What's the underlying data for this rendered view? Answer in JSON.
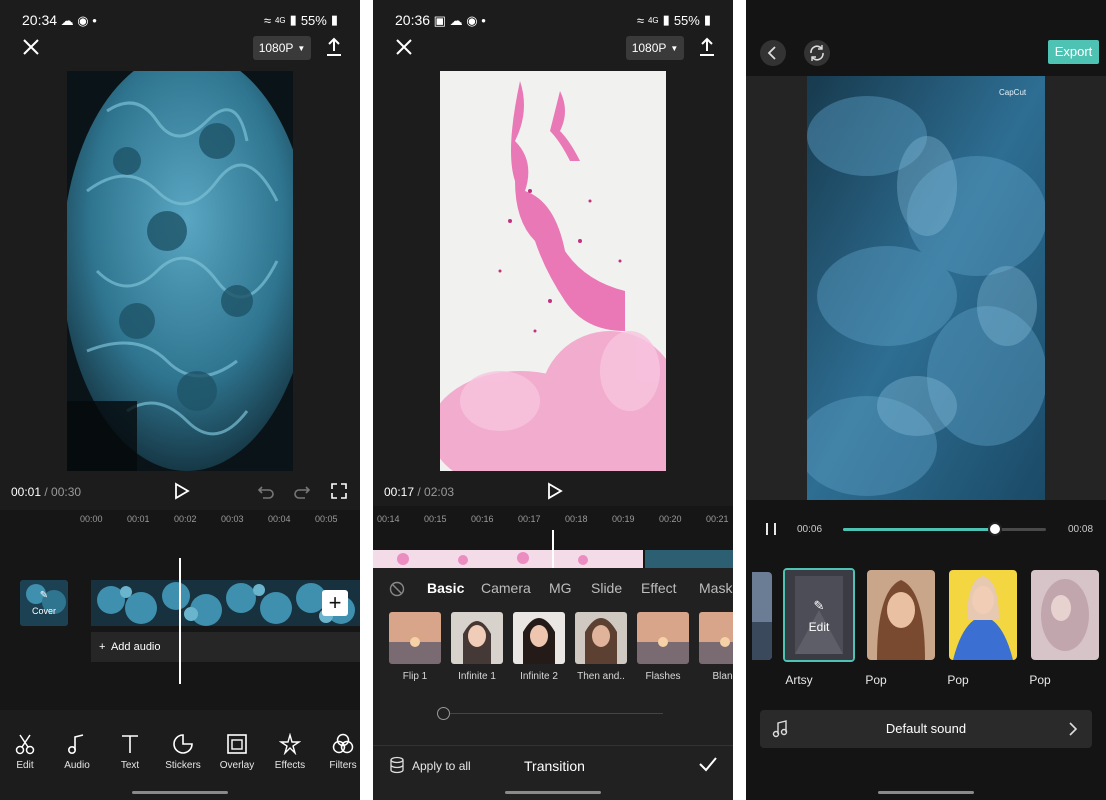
{
  "screen1": {
    "status": {
      "time": "20:34",
      "battery": "55%",
      "signal": "4G"
    },
    "resolution": "1080P",
    "time_current": "00:01",
    "time_total": "/ 00:30",
    "ticks": [
      "00:00",
      "00:01",
      "00:02",
      "00:03",
      "00:04",
      "00:05"
    ],
    "cover_label": "Cover",
    "add_audio": "Add audio",
    "tools": [
      {
        "label": "Edit",
        "icon": "scissors-icon"
      },
      {
        "label": "Audio",
        "icon": "music-note-icon"
      },
      {
        "label": "Text",
        "icon": "text-icon"
      },
      {
        "label": "Stickers",
        "icon": "sticker-icon"
      },
      {
        "label": "Overlay",
        "icon": "overlay-icon"
      },
      {
        "label": "Effects",
        "icon": "effects-icon"
      },
      {
        "label": "Filters",
        "icon": "filters-icon"
      }
    ]
  },
  "screen2": {
    "status": {
      "time": "20:36",
      "battery": "55%",
      "signal": "4G"
    },
    "resolution": "1080P",
    "time_current": "00:17",
    "time_total": "/ 02:03",
    "ticks": [
      "00:14",
      "00:15",
      "00:16",
      "00:17",
      "00:18",
      "00:19",
      "00:20",
      "00:21"
    ],
    "tabs": [
      "Basic",
      "Camera",
      "MG",
      "Slide",
      "Effect",
      "Mask"
    ],
    "transitions": [
      "Flip 1",
      "Infinite 1",
      "Infinite 2",
      "Then and..",
      "Flashes",
      "Blanc"
    ],
    "apply_all": "Apply to all",
    "title": "Transition",
    "slider_value": 0
  },
  "screen3": {
    "export_label": "Export",
    "watermark": "CapCut",
    "time_current": "00:06",
    "time_total": "00:08",
    "progress": 0.75,
    "edit_label": "Edit",
    "templates": [
      "Artsy",
      "Pop",
      "Pop",
      "Pop"
    ],
    "sound_label": "Default sound"
  },
  "colors": {
    "accent": "#4fc3b3",
    "smoke_blue": "#3f8fae",
    "pink": "#e85aa8"
  }
}
